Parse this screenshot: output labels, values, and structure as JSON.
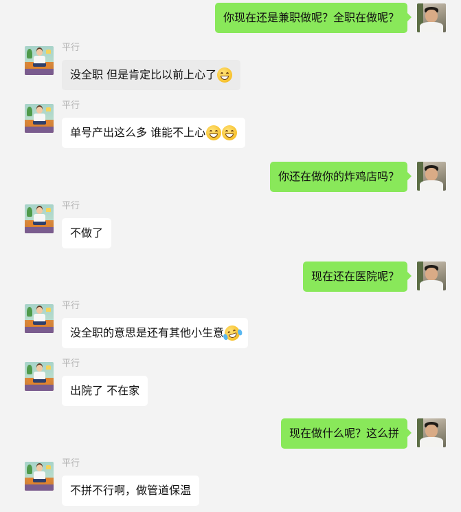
{
  "chat": {
    "contact_name": "平行",
    "messages": [
      {
        "direction": "out",
        "text": "你现在还是兼职做呢？全职在做呢？",
        "emoji": []
      },
      {
        "direction": "in",
        "sender": "平行",
        "text": "没全职 但是肯定比以前上心了",
        "emoji": [
          "grinning-face-emoji"
        ]
      },
      {
        "direction": "in",
        "sender": "平行",
        "text": "单号产出这么多 谁能不上心",
        "emoji": [
          "grinning-face-emoji",
          "grinning-face-emoji"
        ]
      },
      {
        "direction": "out",
        "text": "你还在做你的炸鸡店吗？",
        "emoji": []
      },
      {
        "direction": "in",
        "sender": "平行",
        "text": "不做了",
        "emoji": []
      },
      {
        "direction": "out",
        "text": "现在还在医院呢？",
        "emoji": []
      },
      {
        "direction": "in",
        "sender": "平行",
        "text": "没全职的意思是还有其他小生意",
        "emoji": [
          "rolling-laughing-emoji"
        ]
      },
      {
        "direction": "in",
        "sender": "平行",
        "text": "出院了 不在家",
        "emoji": []
      },
      {
        "direction": "out",
        "text": "现在做什么呢？这么拼",
        "emoji": []
      },
      {
        "direction": "in",
        "sender": "平行",
        "text": "不拼不行啊，做管道保温",
        "emoji": []
      }
    ]
  },
  "colors": {
    "background": "#f3f3f3",
    "outgoing_bubble": "#89e85a",
    "incoming_bubble": "#ffffff",
    "sender_name": "#b2b2b2"
  }
}
